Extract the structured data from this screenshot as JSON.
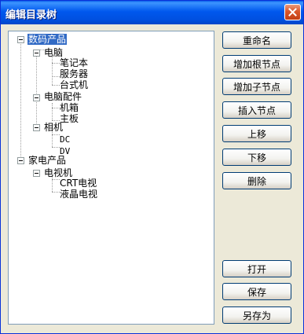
{
  "window": {
    "title": "编辑目录树"
  },
  "tree": {
    "nodes": [
      {
        "label": "数码产品",
        "selected": true
      },
      {
        "label": "电脑"
      },
      {
        "label": "笔记本"
      },
      {
        "label": "服务器"
      },
      {
        "label": "台式机"
      },
      {
        "label": "电脑配件"
      },
      {
        "label": "机箱"
      },
      {
        "label": "主板"
      },
      {
        "label": "相机"
      },
      {
        "label": "DC"
      },
      {
        "label": "DV"
      },
      {
        "label": "家电产品"
      },
      {
        "label": "电视机"
      },
      {
        "label": "CRT电视"
      },
      {
        "label": "液晶电视"
      }
    ]
  },
  "buttons": {
    "rename": "重命名",
    "add_root": "增加根节点",
    "add_child": "增加子节点",
    "insert": "插入节点",
    "move_up": "上移",
    "move_down": "下移",
    "delete": "删除",
    "open": "打开",
    "save": "保存",
    "save_as": "另存为"
  },
  "icons": {
    "close": "close-icon",
    "expander": "minus-expander-icon"
  }
}
